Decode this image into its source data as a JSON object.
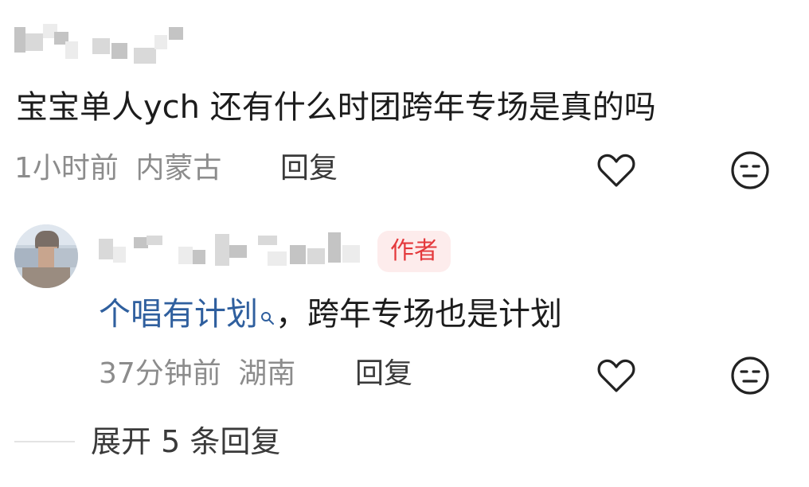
{
  "comment": {
    "text": "宝宝单人ych 还有什么时团跨年专场是真的吗",
    "time": "1小时前",
    "location": "内蒙古",
    "reply_label": "回复"
  },
  "reply": {
    "badge": "作者",
    "link_text": "个唱有计划",
    "link_icon": "search-icon",
    "text_rest": "，跨年专场也是计划",
    "time": "37分钟前",
    "location": "湖南",
    "reply_label": "回复"
  },
  "thread": {
    "expand_label": "展开 5 条回复"
  },
  "icons": {
    "like": "heart-outline-icon",
    "dislike": "neutral-face-icon"
  },
  "colors": {
    "badge_bg": "#fdecec",
    "badge_text": "#e4393c",
    "link": "#2f5f9e",
    "meta": "#8c8c8c"
  }
}
